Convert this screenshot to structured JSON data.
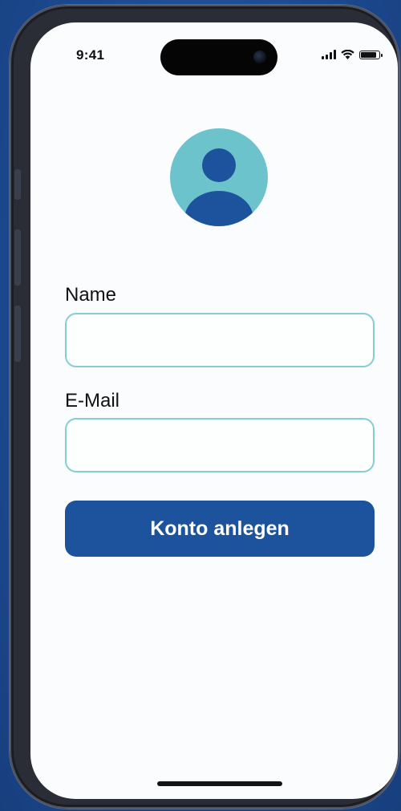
{
  "colors": {
    "background": "#1f4f97",
    "accent": "#1d539d",
    "avatar_bg": "#6cc3cc",
    "field_border": "#84cdd2"
  },
  "status_bar": {
    "time": "9:41",
    "icons": [
      "signal-icon",
      "wifi-icon",
      "battery-icon"
    ]
  },
  "avatar": {
    "icon": "user-avatar-icon"
  },
  "form": {
    "name_label": "Name",
    "name_value": "",
    "email_label": "E-Mail",
    "email_value": "",
    "submit_label": "Konto anlegen"
  }
}
